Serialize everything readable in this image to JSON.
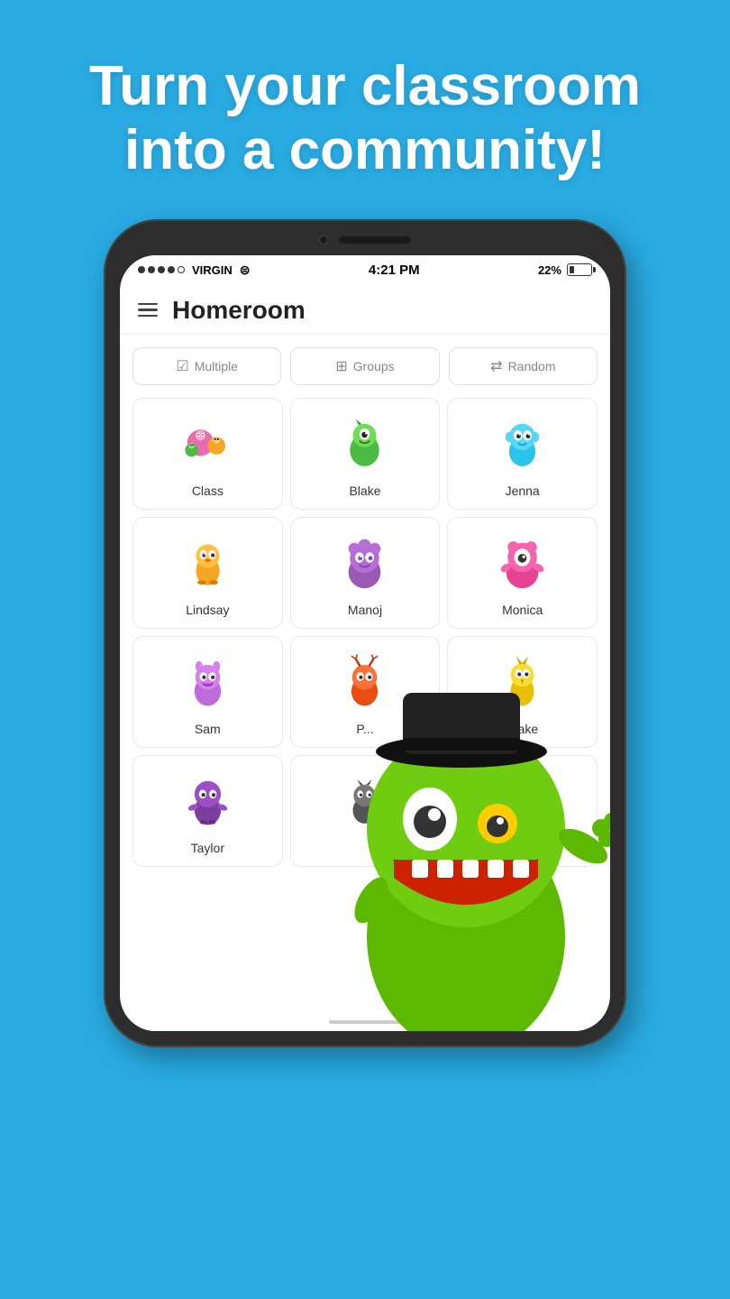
{
  "hero": {
    "line1": "Turn your classroom",
    "line2": "into a community!"
  },
  "status_bar": {
    "signal_dots": 4,
    "carrier": "VIRGIN",
    "time": "4:21 PM",
    "battery_percent": "22%"
  },
  "app": {
    "title": "Homeroom"
  },
  "filters": [
    {
      "id": "multiple",
      "label": "Multiple",
      "icon": "☑"
    },
    {
      "id": "groups",
      "label": "Groups",
      "icon": "⊞"
    },
    {
      "id": "random",
      "label": "Random",
      "icon": "⇄"
    }
  ],
  "students": [
    {
      "id": "class",
      "name": "Class",
      "color": "#e76caf"
    },
    {
      "id": "blake1",
      "name": "Blake",
      "color": "#4cbb44"
    },
    {
      "id": "jenna",
      "name": "Jenna",
      "color": "#2bc4e8"
    },
    {
      "id": "lindsay",
      "name": "Lindsay",
      "color": "#f5a623"
    },
    {
      "id": "manoj",
      "name": "Manoj",
      "color": "#9b59b6"
    },
    {
      "id": "monica",
      "name": "Monica",
      "color": "#e84393"
    },
    {
      "id": "sam",
      "name": "Sam",
      "color": "#c06adb"
    },
    {
      "id": "p",
      "name": "P...",
      "color": "#e84e0f"
    },
    {
      "id": "blake2",
      "name": "Blake",
      "color": "#f0d000"
    },
    {
      "id": "taylor",
      "name": "Taylor",
      "color": "#9b4fc7"
    },
    {
      "id": "extra1",
      "name": "",
      "color": "#e8c344"
    },
    {
      "id": "extra2",
      "name": "",
      "color": "#44bbcc"
    }
  ]
}
